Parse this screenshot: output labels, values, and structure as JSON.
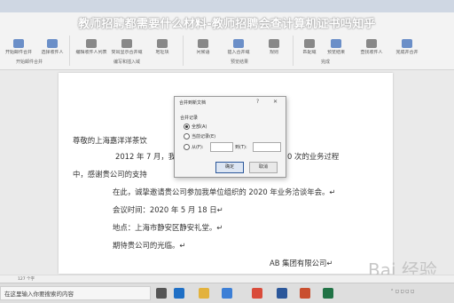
{
  "overlay_title": "教师招聘都需要什么材料-教师招聘会查计算机证书吗知乎",
  "ribbon": {
    "buttons": [
      {
        "label": "开始邮件合并",
        "color": "#6b8fc8"
      },
      {
        "label": "选择收件人",
        "color": "#6b8fc8"
      },
      {
        "label": "编辑收件人列表",
        "color": "#888"
      },
      {
        "label": "突出显示合并域",
        "color": "#888"
      },
      {
        "label": "地址块",
        "color": "#888"
      },
      {
        "label": "问候语",
        "color": "#888"
      },
      {
        "label": "插入合并域",
        "color": "#6b8fc8"
      },
      {
        "label": "规则",
        "color": "#888"
      },
      {
        "label": "匹配域",
        "color": "#888"
      },
      {
        "label": "预览结果",
        "color": "#6b8fc8"
      },
      {
        "label": "查找收件人",
        "color": "#888"
      },
      {
        "label": "完成并合并",
        "color": "#6b8fc8"
      }
    ],
    "groups": [
      "开始邮件合并",
      "编写和插入域",
      "预览结果",
      "完成"
    ]
  },
  "document": {
    "lines": [
      "尊敬的上海嘉洋洋茶饮",
      "2012 年 7 月，我",
      "0 次的业务过程",
      "中，感谢贵公司的支持",
      "在此，诚挚邀请贵公司参加我单位组织的 2020 年业务洽谈年会。↵",
      "会议时间：2020 年 5 月 18 日↵",
      "地点：上海市静安区静安礼堂。↵",
      "期待贵公司的光临。↵",
      "AB 集团有限公司↵"
    ]
  },
  "dialog": {
    "title": "合并到新文档",
    "help": "?",
    "close": "✕",
    "section": "合并记录",
    "options": [
      "全部(A)",
      "当前记录(E)",
      "从(F):"
    ],
    "to_label": "到(T):",
    "ok": "确定",
    "cancel": "取消"
  },
  "statusbar": {
    "text": "127 个字"
  },
  "taskbar": {
    "search_placeholder": "在这里输入你要搜索的内容",
    "icons": [
      {
        "name": "task-view-icon",
        "color": "#555"
      },
      {
        "name": "edge-icon",
        "color": "#1f6fc5"
      },
      {
        "name": "file-explorer-icon",
        "color": "#e3b23c"
      },
      {
        "name": "store-icon",
        "color": "#3c7fd6"
      },
      {
        "name": "chrome-icon",
        "color": "#d94b3a"
      },
      {
        "name": "word-icon",
        "color": "#2b579a"
      },
      {
        "name": "powerpoint-icon",
        "color": "#c94f2f"
      },
      {
        "name": "excel-icon",
        "color": "#217346"
      }
    ]
  },
  "watermark": "Bai 经验"
}
